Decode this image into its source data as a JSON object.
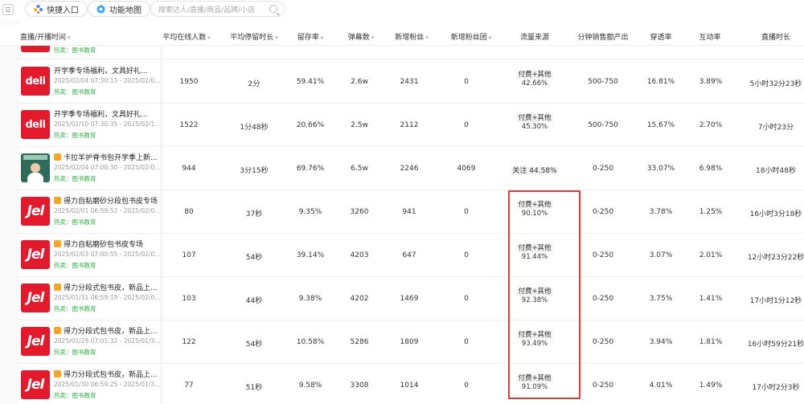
{
  "toolbar": {
    "quick_entry_label": "快捷入口",
    "feature_map_label": "功能地图",
    "search_placeholder": "搜索达人/直播/商品/品牌/小店"
  },
  "table": {
    "headers": {
      "live_open_time": "直播/开播时间",
      "avg_online": "平均在线人数",
      "avg_stay": "平均停留时长",
      "retention": "留存率",
      "danmaku": "弹幕数",
      "new_fans": "新增粉丝",
      "new_fan_groups": "新增粉丝团",
      "traffic_source": "流量来源",
      "sales_per_min": "分钟销售额产出",
      "penetration": "穿透率",
      "interaction": "互动率",
      "duration": "直播时长"
    },
    "partial_row": {
      "hot_sell": "热卖：图书教育"
    },
    "rows": [
      {
        "thumb": "deli",
        "title": "开学季专场福利，文具好礼...",
        "time": "2025/02/04 07:30:13 - 2025/02/04 1...",
        "hot_sell": "热卖：图书教育",
        "avg_online": "1950",
        "avg_stay": "2分",
        "retention": "59.41%",
        "danmaku": "2.6w",
        "new_fans": "2431",
        "new_fan_groups": "0",
        "source_line1": "付费+其他",
        "source_line2": "42.66%",
        "sales_per_min": "500-750",
        "penetration": "16.81%",
        "interaction": "3.89%",
        "duration": "5小时32分23秒"
      },
      {
        "thumb": "deli",
        "title": "开学季专场福利，文具好礼...",
        "time": "2025/02/10 07:30:35 - 2025/02/10 1...",
        "hot_sell": "热卖：图书教育",
        "avg_online": "1522",
        "avg_stay": "1分48秒",
        "retention": "20.66%",
        "danmaku": "2.5w",
        "new_fans": "2112",
        "new_fan_groups": "0",
        "source_line1": "付费+其他",
        "source_line2": "45.30%",
        "sales_per_min": "500-750",
        "penetration": "15.67%",
        "interaction": "2.70%",
        "duration": "7小时23分"
      },
      {
        "thumb": "person",
        "title": "卡拉羊护脊书包开学季上新...",
        "time": "2025/02/04 07:00:30 - 2025/02/05 ...",
        "hot_sell": "热卖：图书教育",
        "avg_online": "944",
        "avg_stay": "3分15秒",
        "retention": "69.76%",
        "danmaku": "6.5w",
        "new_fans": "2246",
        "new_fan_groups": "4069",
        "source_line1": "关注  44.58%",
        "source_line2": "",
        "sales_per_min": "0-250",
        "penetration": "33.07%",
        "interaction": "6.98%",
        "duration": "18小时48秒"
      },
      {
        "thumb": "dell",
        "title": "得力自粘磨砂分段包书皮专场",
        "time": "2025/02/01 06:59:52 - 2025/02/01 2...",
        "hot_sell": "热卖：图书教育",
        "avg_online": "80",
        "avg_stay": "37秒",
        "retention": "9.35%",
        "danmaku": "3260",
        "new_fans": "941",
        "new_fan_groups": "0",
        "source_line1": "付费+其他",
        "source_line2": "90.10%",
        "sales_per_min": "0-250",
        "penetration": "3.78%",
        "interaction": "1.25%",
        "duration": "16小时3分18秒"
      },
      {
        "thumb": "dell",
        "title": "得力自粘磨砂包书皮专场",
        "time": "2025/02/03 07:00:55 - 2025/02/03 1...",
        "hot_sell": "热卖：图书教育",
        "avg_online": "107",
        "avg_stay": "54秒",
        "retention": "39.14%",
        "danmaku": "4203",
        "new_fans": "647",
        "new_fan_groups": "0",
        "source_line1": "付费+其他",
        "source_line2": "91.44%",
        "sales_per_min": "0-250",
        "penetration": "3.07%",
        "interaction": "2.01%",
        "duration": "12小时23分22秒"
      },
      {
        "thumb": "dell",
        "title": "得力分段式包书皮，新品上...",
        "time": "2025/01/31 06:59:19 - 2025/02/01 00...",
        "hot_sell": "热卖：图书教育",
        "avg_online": "103",
        "avg_stay": "44秒",
        "retention": "9.38%",
        "danmaku": "4202",
        "new_fans": "1469",
        "new_fan_groups": "0",
        "source_line1": "付费+其他",
        "source_line2": "92.38%",
        "sales_per_min": "0-250",
        "penetration": "3.75%",
        "interaction": "1.41%",
        "duration": "17小时1分12秒"
      },
      {
        "thumb": "dell",
        "title": "得力分段式包书皮，新品上...",
        "time": "2025/01/29 07:01:32 - 2025/01/30 0...",
        "hot_sell": "热卖：图书教育",
        "avg_online": "122",
        "avg_stay": "54秒",
        "retention": "10.58%",
        "danmaku": "5286",
        "new_fans": "1809",
        "new_fan_groups": "0",
        "source_line1": "付费+其他",
        "source_line2": "93.49%",
        "sales_per_min": "0-250",
        "penetration": "3.94%",
        "interaction": "1.81%",
        "duration": "16小时59分21秒"
      },
      {
        "thumb": "dell",
        "title": "得力分段式包书皮，新品上...",
        "time": "2025/01/30 06:59:25 - 2025/01/30 2...",
        "hot_sell": "热卖：图书教育",
        "avg_online": "77",
        "avg_stay": "51秒",
        "retention": "9.58%",
        "danmaku": "3308",
        "new_fans": "1014",
        "new_fan_groups": "0",
        "source_line1": "付费+其他",
        "source_line2": "91.09%",
        "sales_per_min": "0-250",
        "penetration": "4.01%",
        "interaction": "1.49%",
        "duration": "17小时2分3秒"
      }
    ]
  },
  "logos": {
    "deli": "deli",
    "dell": "Jel"
  },
  "colors": {
    "brand_red": "#e21a2c",
    "highlight_red": "#e53935",
    "hot_green": "#2fb344"
  }
}
